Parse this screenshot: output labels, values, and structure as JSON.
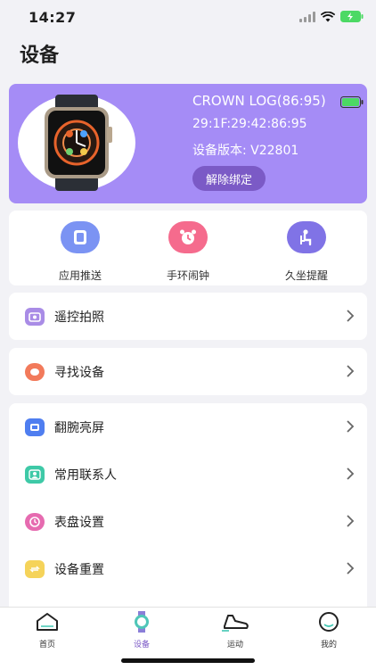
{
  "status_bar": {
    "time": "14:27"
  },
  "page": {
    "title": "设备"
  },
  "device": {
    "name": "CROWN LOG(86:95)",
    "mac": "29:1F:29:42:86:95",
    "version": "设备版本: V22801",
    "unbind_label": "解除绑定",
    "battery_level": 1.0
  },
  "quick_actions": [
    {
      "label": "应用推送",
      "icon": "app-push-icon",
      "color": "#6f8cf5"
    },
    {
      "label": "手环闹钟",
      "icon": "alarm-clock-icon",
      "color": "#f55a7e"
    },
    {
      "label": "久坐提醒",
      "icon": "sedentary-icon",
      "color": "#7c6ee8"
    }
  ],
  "menu_groups": [
    [
      {
        "label": "遥控拍照",
        "icon": "camera-icon",
        "color": "#a98ce6"
      }
    ],
    [
      {
        "label": "寻找设备",
        "icon": "find-device-icon",
        "color": "#f27a5b"
      }
    ],
    [
      {
        "label": "翻腕亮屏",
        "icon": "wrist-screen-icon",
        "color": "#4f7ef0"
      },
      {
        "label": "常用联系人",
        "icon": "contacts-icon",
        "color": "#3ec9a7"
      },
      {
        "label": "表盘设置",
        "icon": "watch-face-icon",
        "color": "#e66bb0"
      },
      {
        "label": "设备重置",
        "icon": "reset-icon",
        "color": "#f2c94c"
      }
    ]
  ],
  "tabs": [
    {
      "label": "首页",
      "icon": "home-icon",
      "active": false
    },
    {
      "label": "设备",
      "icon": "device-tab-icon",
      "active": true
    },
    {
      "label": "运动",
      "icon": "sport-icon",
      "active": false
    },
    {
      "label": "我的",
      "icon": "profile-icon",
      "active": false
    }
  ],
  "colors": {
    "accent": "#a58cf6",
    "unbind_bg": "#7b5ac6",
    "battery": "#4cd964"
  }
}
